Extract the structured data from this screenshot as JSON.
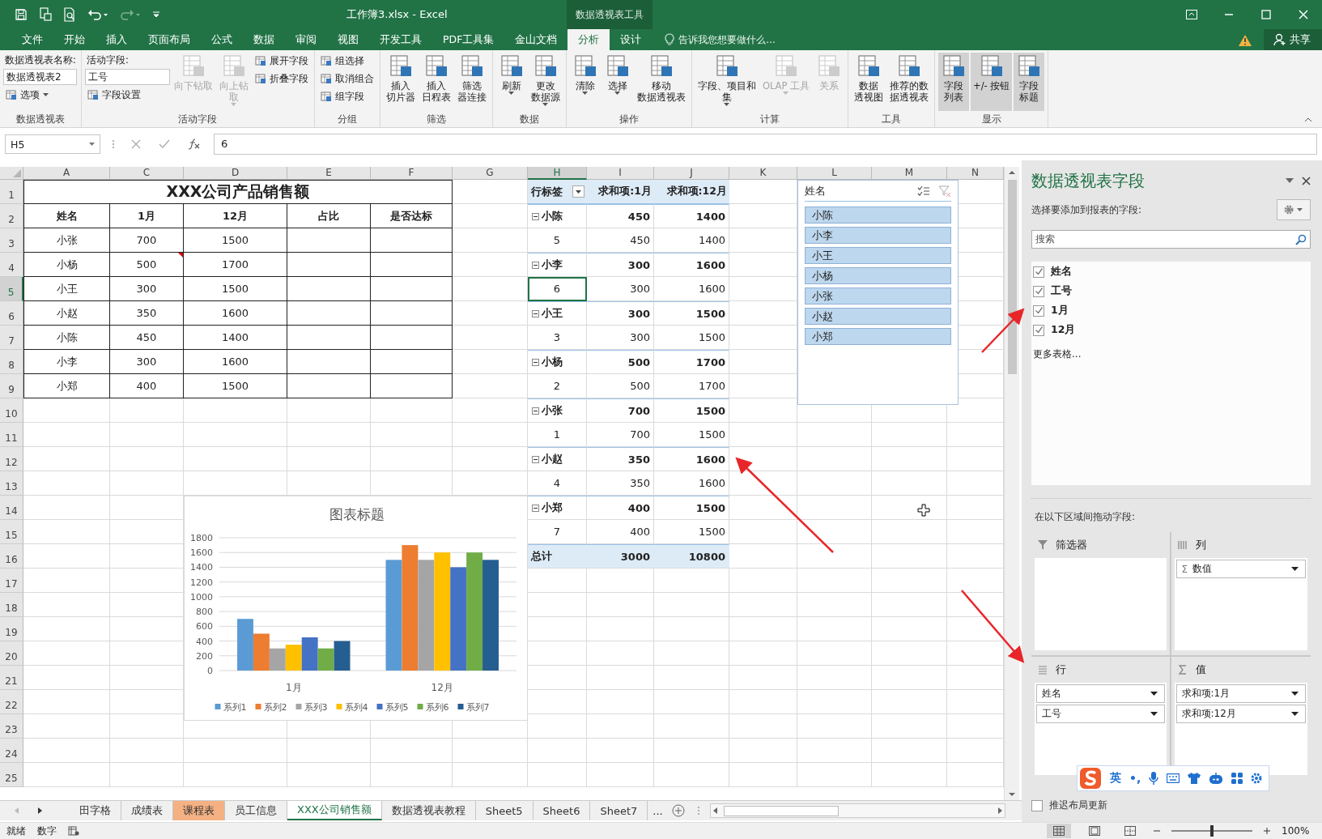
{
  "window": {
    "title": "工作簿3.xlsx - Excel",
    "context_tool": "数据透视表工具"
  },
  "tabs": [
    {
      "label": "文件",
      "selected": false
    },
    {
      "label": "开始",
      "selected": false
    },
    {
      "label": "插入",
      "selected": false
    },
    {
      "label": "页面布局",
      "selected": false
    },
    {
      "label": "公式",
      "selected": false
    },
    {
      "label": "数据",
      "selected": false
    },
    {
      "label": "审阅",
      "selected": false
    },
    {
      "label": "视图",
      "selected": false
    },
    {
      "label": "开发工具",
      "selected": false
    },
    {
      "label": "PDF工具集",
      "selected": false
    },
    {
      "label": "金山文档",
      "selected": false
    },
    {
      "label": "分析",
      "selected": true
    },
    {
      "label": "设计",
      "selected": false
    }
  ],
  "tell_me": {
    "placeholder": "告诉我您想要做什么..."
  },
  "share": "共享",
  "ribbon": {
    "groups": [
      {
        "label": "数据透视表",
        "columns": [
          [
            {
              "kind": "caption",
              "text": "数据透视表名称:"
            },
            {
              "kind": "field",
              "value": "数据透视表2"
            },
            {
              "kind": "small",
              "text": "选项",
              "dropdown": true
            }
          ]
        ]
      },
      {
        "label": "活动字段",
        "columns": [
          [
            {
              "kind": "caption",
              "text": "活动字段:"
            },
            {
              "kind": "field",
              "value": "工号"
            },
            {
              "kind": "small",
              "text": "字段设置",
              "dropdown": false
            }
          ],
          [
            {
              "kind": "large",
              "lines": [
                "向下钻取"
              ],
              "dropdown": false,
              "disabled": true,
              "on": false
            }
          ],
          [
            {
              "kind": "large",
              "lines": [
                "向上钻",
                "取"
              ],
              "dropdown": true,
              "disabled": true,
              "on": false
            }
          ],
          [
            {
              "kind": "small",
              "text": "展开字段",
              "dropdown": false
            },
            {
              "kind": "small",
              "text": "折叠字段",
              "dropdown": false
            }
          ]
        ]
      },
      {
        "label": "分组",
        "columns": [
          [
            {
              "kind": "small",
              "text": "组选择",
              "dropdown": false
            },
            {
              "kind": "small",
              "text": "取消组合",
              "dropdown": false
            },
            {
              "kind": "small",
              "text": "组字段",
              "dropdown": false
            }
          ]
        ]
      },
      {
        "label": "筛选",
        "columns": [
          [
            {
              "kind": "large",
              "lines": [
                "插入",
                "切片器"
              ],
              "dropdown": false,
              "disabled": false,
              "on": false
            }
          ],
          [
            {
              "kind": "large",
              "lines": [
                "插入",
                "日程表"
              ],
              "dropdown": false,
              "disabled": false,
              "on": false
            }
          ],
          [
            {
              "kind": "large",
              "lines": [
                "筛选",
                "器连接"
              ],
              "dropdown": false,
              "disabled": false,
              "on": false
            }
          ]
        ]
      },
      {
        "label": "数据",
        "columns": [
          [
            {
              "kind": "large",
              "lines": [
                "刷新"
              ],
              "dropdown": true,
              "disabled": false,
              "on": false
            }
          ],
          [
            {
              "kind": "large",
              "lines": [
                "更改",
                "数据源"
              ],
              "dropdown": true,
              "disabled": false,
              "on": false
            }
          ]
        ]
      },
      {
        "label": "操作",
        "columns": [
          [
            {
              "kind": "large",
              "lines": [
                "清除"
              ],
              "dropdown": true,
              "disabled": false,
              "on": false
            }
          ],
          [
            {
              "kind": "large",
              "lines": [
                "选择"
              ],
              "dropdown": true,
              "disabled": false,
              "on": false
            }
          ],
          [
            {
              "kind": "large",
              "lines": [
                "移动",
                "数据透视表"
              ],
              "dropdown": false,
              "disabled": false,
              "on": false
            }
          ]
        ]
      },
      {
        "label": "计算",
        "columns": [
          [
            {
              "kind": "large",
              "lines": [
                "字段、项目和",
                "集"
              ],
              "dropdown": true,
              "disabled": false,
              "on": false
            }
          ],
          [
            {
              "kind": "large",
              "lines": [
                "OLAP 工具"
              ],
              "dropdown": true,
              "disabled": true,
              "on": false
            }
          ],
          [
            {
              "kind": "large",
              "lines": [
                "关系"
              ],
              "dropdown": false,
              "disabled": true,
              "on": false
            }
          ]
        ]
      },
      {
        "label": "工具",
        "columns": [
          [
            {
              "kind": "large",
              "lines": [
                "数据",
                "透视图"
              ],
              "dropdown": false,
              "disabled": false,
              "on": false
            }
          ],
          [
            {
              "kind": "large",
              "lines": [
                "推荐的数",
                "据透视表"
              ],
              "dropdown": false,
              "disabled": false,
              "on": false
            }
          ]
        ]
      },
      {
        "label": "显示",
        "columns": [
          [
            {
              "kind": "large",
              "lines": [
                "字段",
                "列表"
              ],
              "dropdown": false,
              "disabled": false,
              "on": true
            }
          ],
          [
            {
              "kind": "large",
              "lines": [
                "+/- 按钮"
              ],
              "dropdown": false,
              "disabled": false,
              "on": true
            }
          ],
          [
            {
              "kind": "large",
              "lines": [
                "字段",
                "标题"
              ],
              "dropdown": false,
              "disabled": false,
              "on": true
            }
          ]
        ]
      }
    ]
  },
  "formula_bar": {
    "name_box": "H5",
    "value": "6"
  },
  "sheet": {
    "columns": [
      "A",
      "C",
      "D",
      "E",
      "F",
      "G",
      "H",
      "I",
      "J",
      "K",
      "L",
      "M",
      "N"
    ],
    "rows": [
      {
        "number": "1",
        "cells": [
          {
            "text": "XXX公司产品销售额",
            "kind": "title",
            "selected": false
          },
          null,
          null,
          null,
          null,
          null,
          {
            "text": "行标签",
            "kind": "pivot-head",
            "selected": false
          },
          {
            "text": "求和项:1月",
            "kind": "pivot-col",
            "selected": false
          },
          {
            "text": "求和项:12月",
            "kind": "pivot-col",
            "selected": false
          }
        ]
      },
      {
        "number": "2",
        "cells": [
          {
            "text": "姓名",
            "kind": "header",
            "selected": false
          },
          {
            "text": "1月",
            "kind": "header",
            "selected": false
          },
          {
            "text": "12月",
            "kind": "header",
            "selected": false
          },
          {
            "text": "占比",
            "kind": "header",
            "selected": false
          },
          {
            "text": "是否达标",
            "kind": "header",
            "selected": false
          },
          null,
          {
            "text": "小陈",
            "kind": "group-label",
            "selected": false
          },
          {
            "text": "450",
            "kind": "group-value",
            "selected": false
          },
          {
            "text": "1400",
            "kind": "group-value",
            "selected": false
          }
        ]
      },
      {
        "number": "3",
        "cells": [
          {
            "text": "小张",
            "kind": "data",
            "selected": false
          },
          {
            "text": "700",
            "kind": "data",
            "selected": false
          },
          {
            "text": "1500",
            "kind": "data",
            "selected": false
          },
          {
            "kind": "data",
            "selected": false
          },
          {
            "kind": "data",
            "selected": false
          },
          null,
          {
            "text": "5",
            "kind": "item-label",
            "selected": false
          },
          {
            "text": "450",
            "kind": "item-value",
            "selected": false
          },
          {
            "text": "1400",
            "kind": "item-value",
            "selected": false
          }
        ]
      },
      {
        "number": "4",
        "cells": [
          {
            "text": "小杨",
            "kind": "data",
            "selected": false
          },
          {
            "text": "500",
            "kind": "data",
            "selected": false,
            "comment": true
          },
          {
            "text": "1700",
            "kind": "data",
            "selected": false
          },
          {
            "kind": "data",
            "selected": false
          },
          {
            "kind": "data",
            "selected": false
          },
          null,
          {
            "text": "小李",
            "kind": "group-label",
            "selected": false
          },
          {
            "text": "300",
            "kind": "group-value",
            "selected": false
          },
          {
            "text": "1600",
            "kind": "group-value",
            "selected": false
          }
        ]
      },
      {
        "number": "5",
        "cells": [
          {
            "text": "小王",
            "kind": "data",
            "selected": false
          },
          {
            "text": "300",
            "kind": "data",
            "selected": false
          },
          {
            "text": "1500",
            "kind": "data",
            "selected": false
          },
          {
            "kind": "data",
            "selected": false
          },
          {
            "kind": "data",
            "selected": false
          },
          null,
          {
            "text": "6",
            "kind": "item-label",
            "selected": true
          },
          {
            "text": "300",
            "kind": "item-value",
            "selected": false
          },
          {
            "text": "1600",
            "kind": "item-value",
            "selected": false
          }
        ]
      },
      {
        "number": "6",
        "cells": [
          {
            "text": "小赵",
            "kind": "data",
            "selected": false
          },
          {
            "text": "350",
            "kind": "data",
            "selected": false
          },
          {
            "text": "1600",
            "kind": "data",
            "selected": false
          },
          {
            "kind": "data",
            "selected": false
          },
          {
            "kind": "data",
            "selected": false
          },
          null,
          {
            "text": "小王",
            "kind": "group-label",
            "selected": false
          },
          {
            "text": "300",
            "kind": "group-value",
            "selected": false
          },
          {
            "text": "1500",
            "kind": "group-value",
            "selected": false
          }
        ]
      },
      {
        "number": "7",
        "cells": [
          {
            "text": "小陈",
            "kind": "data",
            "selected": false
          },
          {
            "text": "450",
            "kind": "data",
            "selected": false
          },
          {
            "text": "1400",
            "kind": "data",
            "selected": false
          },
          {
            "kind": "data",
            "selected": false
          },
          {
            "kind": "data",
            "selected": false
          },
          null,
          {
            "text": "3",
            "kind": "item-label",
            "selected": false
          },
          {
            "text": "300",
            "kind": "item-value",
            "selected": false
          },
          {
            "text": "1500",
            "kind": "item-value",
            "selected": false
          }
        ]
      },
      {
        "number": "8",
        "cells": [
          {
            "text": "小李",
            "kind": "data",
            "selected": false
          },
          {
            "text": "300",
            "kind": "data",
            "selected": false
          },
          {
            "text": "1600",
            "kind": "data",
            "selected": false
          },
          {
            "kind": "data",
            "selected": false
          },
          {
            "kind": "data",
            "selected": false
          },
          null,
          {
            "text": "小杨",
            "kind": "group-label",
            "selected": false
          },
          {
            "text": "500",
            "kind": "group-value",
            "selected": false
          },
          {
            "text": "1700",
            "kind": "group-value",
            "selected": false
          }
        ]
      },
      {
        "number": "9",
        "cells": [
          {
            "text": "小郑",
            "kind": "data",
            "selected": false
          },
          {
            "text": "400",
            "kind": "data",
            "selected": false
          },
          {
            "text": "1500",
            "kind": "data",
            "selected": false
          },
          {
            "kind": "data",
            "selected": false
          },
          {
            "kind": "data",
            "selected": false
          },
          null,
          {
            "text": "2",
            "kind": "item-label",
            "selected": false
          },
          {
            "text": "500",
            "kind": "item-value",
            "selected": false
          },
          {
            "text": "1700",
            "kind": "item-value",
            "selected": false
          }
        ]
      },
      {
        "number": "10",
        "cells": [
          null,
          null,
          null,
          null,
          null,
          null,
          {
            "text": "小张",
            "kind": "group-label",
            "selected": false
          },
          {
            "text": "700",
            "kind": "group-value",
            "selected": false
          },
          {
            "text": "1500",
            "kind": "group-value",
            "selected": false
          }
        ]
      },
      {
        "number": "11",
        "cells": [
          null,
          null,
          null,
          null,
          null,
          null,
          {
            "text": "1",
            "kind": "item-label",
            "selected": false
          },
          {
            "text": "700",
            "kind": "item-value",
            "selected": false
          },
          {
            "text": "1500",
            "kind": "item-value",
            "selected": false
          }
        ]
      },
      {
        "number": "12",
        "cells": [
          null,
          null,
          null,
          null,
          null,
          null,
          {
            "text": "小赵",
            "kind": "group-label",
            "selected": false
          },
          {
            "text": "350",
            "kind": "group-value",
            "selected": false
          },
          {
            "text": "1600",
            "kind": "group-value",
            "selected": false
          }
        ]
      },
      {
        "number": "13",
        "cells": [
          null,
          null,
          null,
          null,
          null,
          null,
          {
            "text": "4",
            "kind": "item-label",
            "selected": false
          },
          {
            "text": "350",
            "kind": "item-value",
            "selected": false
          },
          {
            "text": "1600",
            "kind": "item-value",
            "selected": false
          }
        ]
      },
      {
        "number": "14",
        "cells": [
          null,
          null,
          null,
          null,
          null,
          null,
          {
            "text": "小郑",
            "kind": "group-label",
            "selected": false
          },
          {
            "text": "400",
            "kind": "group-value",
            "selected": false
          },
          {
            "text": "1500",
            "kind": "group-value",
            "selected": false
          }
        ]
      },
      {
        "number": "15",
        "cells": [
          null,
          null,
          null,
          null,
          null,
          null,
          {
            "text": "7",
            "kind": "item-label",
            "selected": false
          },
          {
            "text": "400",
            "kind": "item-value",
            "selected": false
          },
          {
            "text": "1500",
            "kind": "item-value",
            "selected": false
          }
        ]
      },
      {
        "number": "16",
        "cells": [
          null,
          null,
          null,
          null,
          null,
          null,
          {
            "text": "总计",
            "kind": "total-label",
            "selected": false
          },
          {
            "text": "3000",
            "kind": "total-value",
            "selected": false
          },
          {
            "text": "10800",
            "kind": "total-value",
            "selected": false
          }
        ]
      },
      {
        "number": "17"
      },
      {
        "number": "18"
      },
      {
        "number": "19"
      },
      {
        "number": "20"
      },
      {
        "number": "21"
      },
      {
        "number": "22"
      },
      {
        "number": "23"
      },
      {
        "number": "24"
      },
      {
        "number": "25"
      }
    ],
    "chart": {
      "chart_data": {
        "type": "bar",
        "title": "图表标题",
        "grid": true,
        "legend": true,
        "categories": [
          "1月",
          "12月"
        ],
        "ylim": [
          0,
          1800
        ],
        "yticks": [
          0,
          200,
          400,
          600,
          800,
          1000,
          1200,
          1400,
          1600,
          1800
        ],
        "series": [
          {
            "name": "系列1",
            "color": "#5b9bd5",
            "values": [
              700,
              1500
            ]
          },
          {
            "name": "系列2",
            "color": "#ed7d31",
            "values": [
              500,
              1700
            ]
          },
          {
            "name": "系列3",
            "color": "#a5a5a5",
            "values": [
              300,
              1500
            ]
          },
          {
            "name": "系列4",
            "color": "#ffc000",
            "values": [
              350,
              1600
            ]
          },
          {
            "name": "系列5",
            "color": "#4472c4",
            "values": [
              450,
              1400
            ]
          },
          {
            "name": "系列6",
            "color": "#70ad47",
            "values": [
              300,
              1600
            ]
          },
          {
            "name": "系列7",
            "color": "#255e91",
            "values": [
              400,
              1500
            ]
          }
        ]
      }
    },
    "slicer": {
      "title": "姓名",
      "items": [
        {
          "label": "小陈",
          "selected": true
        },
        {
          "label": "小李",
          "selected": true
        },
        {
          "label": "小王",
          "selected": true
        },
        {
          "label": "小杨",
          "selected": true
        },
        {
          "label": "小张",
          "selected": true
        },
        {
          "label": "小赵",
          "selected": true
        },
        {
          "label": "小郑",
          "selected": true
        }
      ]
    }
  },
  "sheet_tabs": {
    "tabs": [
      {
        "label": "田字格",
        "selected": false
      },
      {
        "label": "成绩表",
        "selected": false
      },
      {
        "label": "课程表",
        "selected": false,
        "color": "#f4b183"
      },
      {
        "label": "员工信息",
        "selected": false
      },
      {
        "label": "XXX公司销售额",
        "selected": true
      },
      {
        "label": "数据透视表教程",
        "selected": false
      },
      {
        "label": "Sheet5",
        "selected": false
      },
      {
        "label": "Sheet6",
        "selected": false
      },
      {
        "label": "Sheet7",
        "selected": false
      }
    ],
    "more": "..."
  },
  "field_pane": {
    "title": "数据透视表字段",
    "subtitle": "选择要添加到报表的字段:",
    "search": {
      "placeholder": "搜索"
    },
    "fields": [
      {
        "label": "姓名",
        "checked": true
      },
      {
        "label": "工号",
        "checked": true
      },
      {
        "label": "1月",
        "checked": true
      },
      {
        "label": "12月",
        "checked": true
      }
    ],
    "more_tables": "更多表格...",
    "drag_hint": "在以下区域间拖动字段:",
    "areas": [
      {
        "kind": "filter",
        "label": "筛选器"
      },
      {
        "kind": "columns",
        "label": "列",
        "items": [
          {
            "symbol": "Σ",
            "label": "数值"
          }
        ]
      },
      {
        "kind": "rows",
        "label": "行",
        "items": [
          {
            "label": "姓名"
          },
          {
            "label": "工号"
          }
        ]
      },
      {
        "kind": "values",
        "label": "值",
        "items": [
          {
            "label": "求和项:1月"
          },
          {
            "label": "求和项:12月"
          }
        ]
      }
    ],
    "defer_update": {
      "label": "推迟布局更新",
      "checked": false
    }
  },
  "ime_toolbar": {
    "language": "英",
    "punctuation": "•,"
  },
  "status_bar": {
    "items": [
      "就绪",
      "数字"
    ],
    "views": [
      {
        "selected": true
      },
      {
        "selected": false
      },
      {
        "selected": false
      }
    ],
    "zoom": {
      "level": 0.5,
      "reading": "100%"
    }
  }
}
